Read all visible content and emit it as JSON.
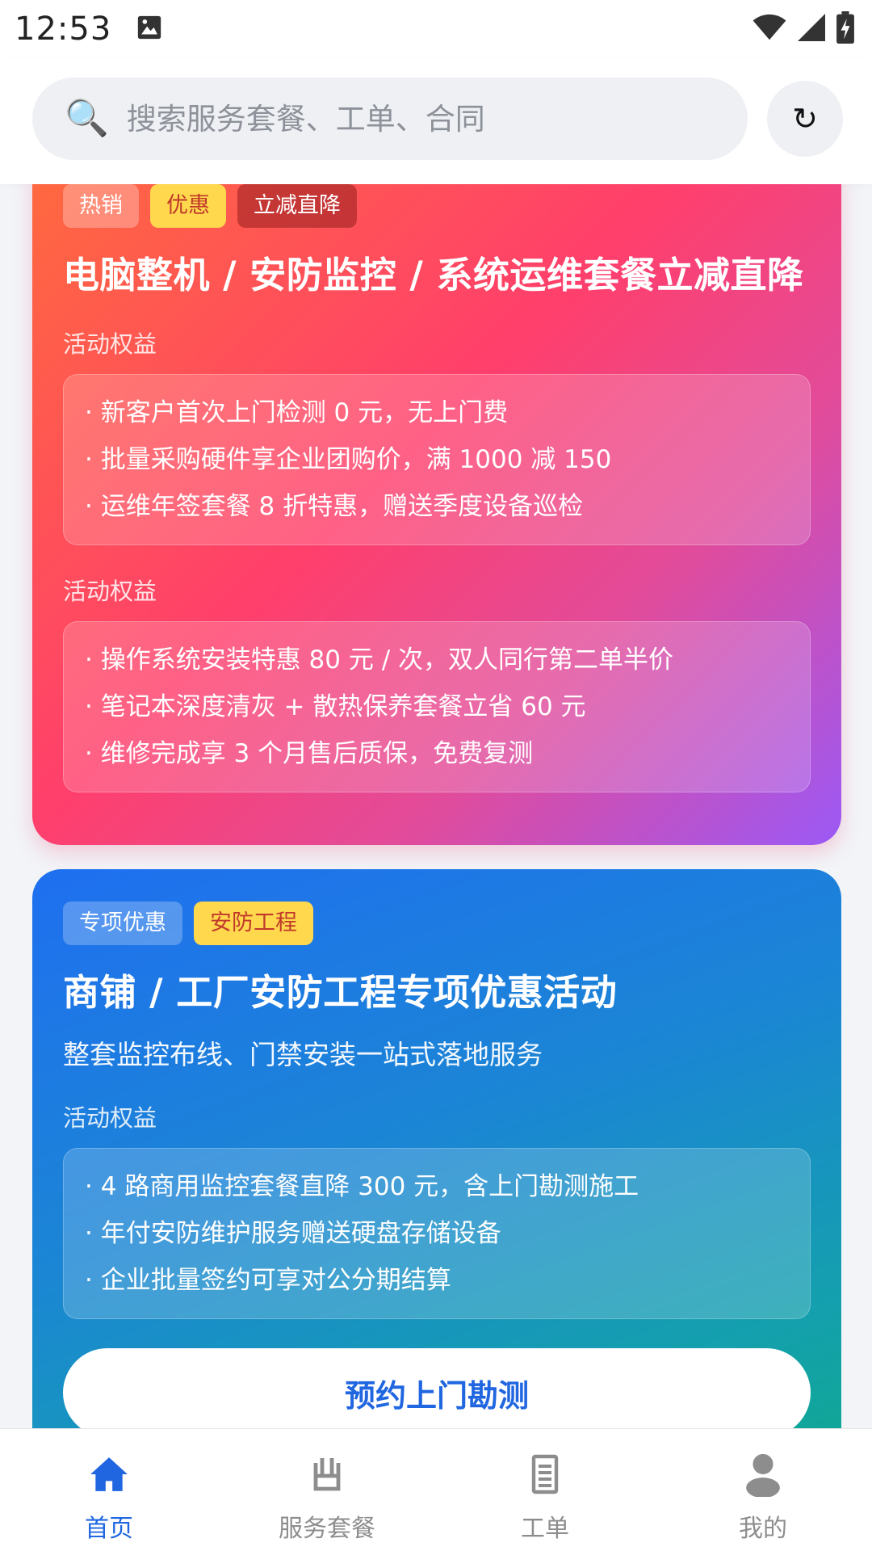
{
  "status_bar": {
    "time": "12:53"
  },
  "search": {
    "placeholder": "搜索服务套餐、工单、合同",
    "refresh_glyph": "↻"
  },
  "cards": [
    {
      "tags": [
        "热销",
        "优惠",
        "立减直降"
      ],
      "title": "电脑整机 / 安防监控 / 系统运维套餐立减直降",
      "sections": [
        {
          "label": "活动权益",
          "items": [
            "· 新客户首次上门检测 0 元，无上门费",
            "· 批量采购硬件享企业团购价，满 1000 减 150",
            "· 运维年签套餐 8 折特惠，赠送季度设备巡检"
          ]
        },
        {
          "label": "活动权益",
          "items": [
            "· 操作系统安装特惠 80 元 / 次，双人同行第二单半价",
            "· 笔记本深度清灰 + 散热保养套餐立省 60 元",
            "· 维修完成享 3 个月售后质保，免费复测"
          ]
        }
      ]
    },
    {
      "tags": [
        "专项优惠",
        "安防工程"
      ],
      "title": "商铺 / 工厂安防工程专项优惠活动",
      "subtitle": "整套监控布线、门禁安装一站式落地服务",
      "sections": [
        {
          "label": "活动权益",
          "items": [
            "· 4 路商用监控套餐直降 300 元，含上门勘测施工",
            "· 年付安防维护服务赠送硬盘存储设备",
            "· 企业批量签约可享对公分期结算"
          ]
        }
      ],
      "cta": "预约上门勘测"
    }
  ],
  "bottom_nav": {
    "items": [
      {
        "label": "首页",
        "icon": "home-icon",
        "active": true
      },
      {
        "label": "服务套餐",
        "icon": "package-icon",
        "active": false
      },
      {
        "label": "工单",
        "icon": "document-icon",
        "active": false
      },
      {
        "label": "我的",
        "icon": "person-icon",
        "active": false
      }
    ]
  },
  "colors": {
    "accent": "#1f66e0"
  }
}
